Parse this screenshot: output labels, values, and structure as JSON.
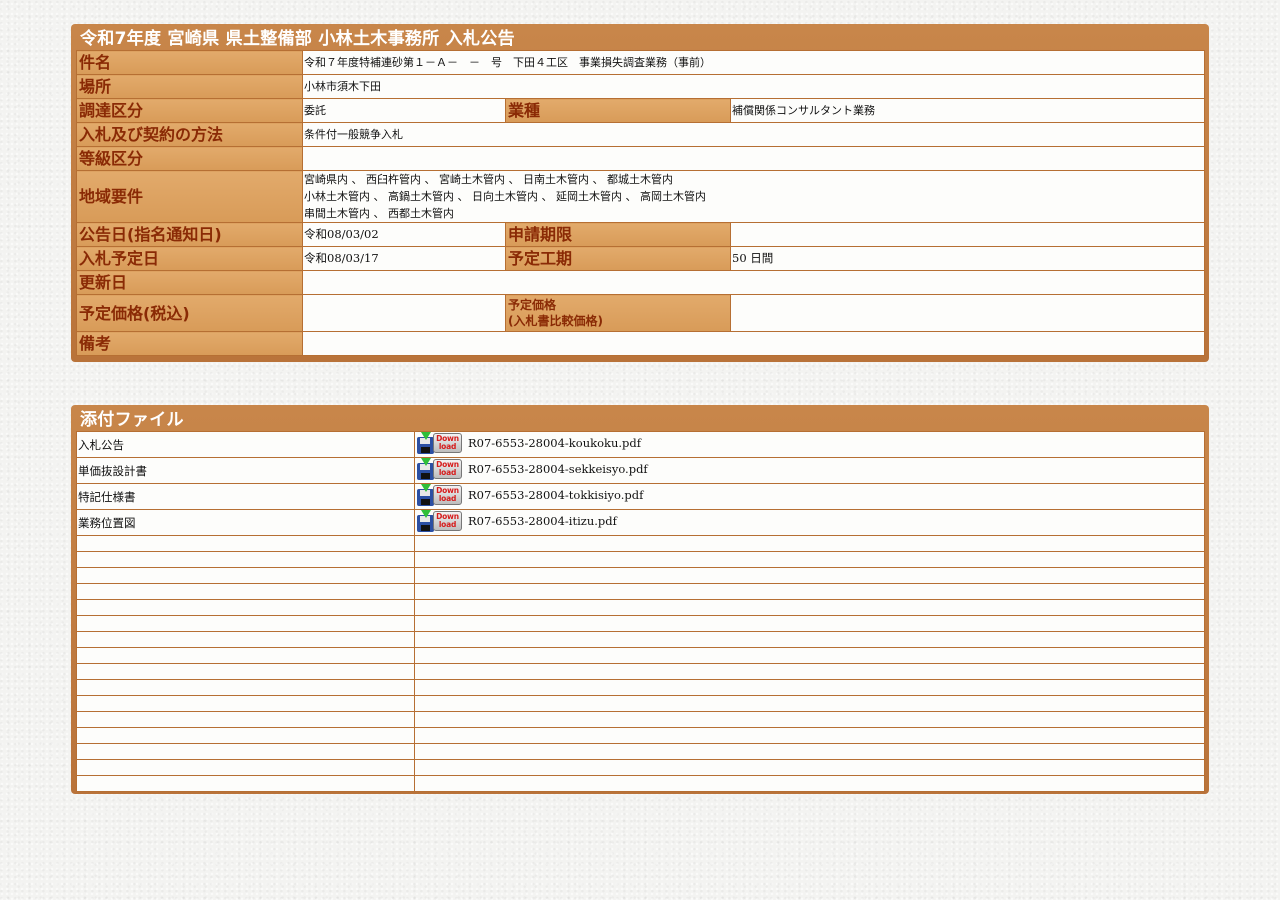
{
  "notice": {
    "title": "令和7年度  宮崎県  県土整備部  小林土木事務所  入札公告",
    "rows": {
      "subject": {
        "label": "件名",
        "value": "令和７年度特補連砂第１－Ａ－　－　号　下田４工区　事業損失調査業務（事前）"
      },
      "place": {
        "label": "場所",
        "value": "小林市須木下田"
      },
      "procurement": {
        "label": "調達区分",
        "value": "委託",
        "label2": "業種",
        "value2": "補償関係コンサルタント業務"
      },
      "method": {
        "label": "入札及び契約の方法",
        "value": "条件付一般競争入札"
      },
      "grade": {
        "label": "等級区分",
        "value": ""
      },
      "region": {
        "label": "地域要件",
        "lines": [
          "宮崎県内 、 西臼杵管内 、 宮崎土木管内 、 日南土木管内 、 都城土木管内",
          "小林土木管内 、 高鍋土木管内 、 日向土木管内 、 延岡土木管内 、 高岡土木管内",
          "串間土木管内 、 西都土木管内"
        ]
      },
      "announce_date": {
        "label": "公告日(指名通知日)",
        "value": "令和08/03/02",
        "label2": "申請期限",
        "value2": ""
      },
      "bid_date": {
        "label": "入札予定日",
        "value": "令和08/03/17",
        "label2": "予定工期",
        "value2": "50 日間"
      },
      "updated": {
        "label": "更新日",
        "value": ""
      },
      "price": {
        "label": "予定価格(税込)",
        "value": "",
        "label2_line1": "予定価格",
        "label2_line2": "(入札書比較価格)",
        "value2": ""
      },
      "remarks": {
        "label": "備考",
        "value": ""
      }
    }
  },
  "attachments": {
    "title": "添付ファイル",
    "download_badge_top": "Down",
    "download_badge_bottom": "load",
    "files": [
      {
        "name": "入札公告",
        "filename": "R07-6553-28004-koukoku.pdf"
      },
      {
        "name": "単価抜設計書",
        "filename": "R07-6553-28004-sekkeisyo.pdf"
      },
      {
        "name": "特記仕様書",
        "filename": "R07-6553-28004-tokkisiyo.pdf"
      },
      {
        "name": "業務位置図",
        "filename": "R07-6553-28004-itizu.pdf"
      }
    ],
    "empty_row_count": 16
  },
  "colors": {
    "frame": "#c27c3e",
    "label_bg": "#dea463",
    "label_text": "#8a2a05",
    "title_text": "#ffffff"
  },
  "icons": {
    "download": "floppy-download-icon"
  }
}
